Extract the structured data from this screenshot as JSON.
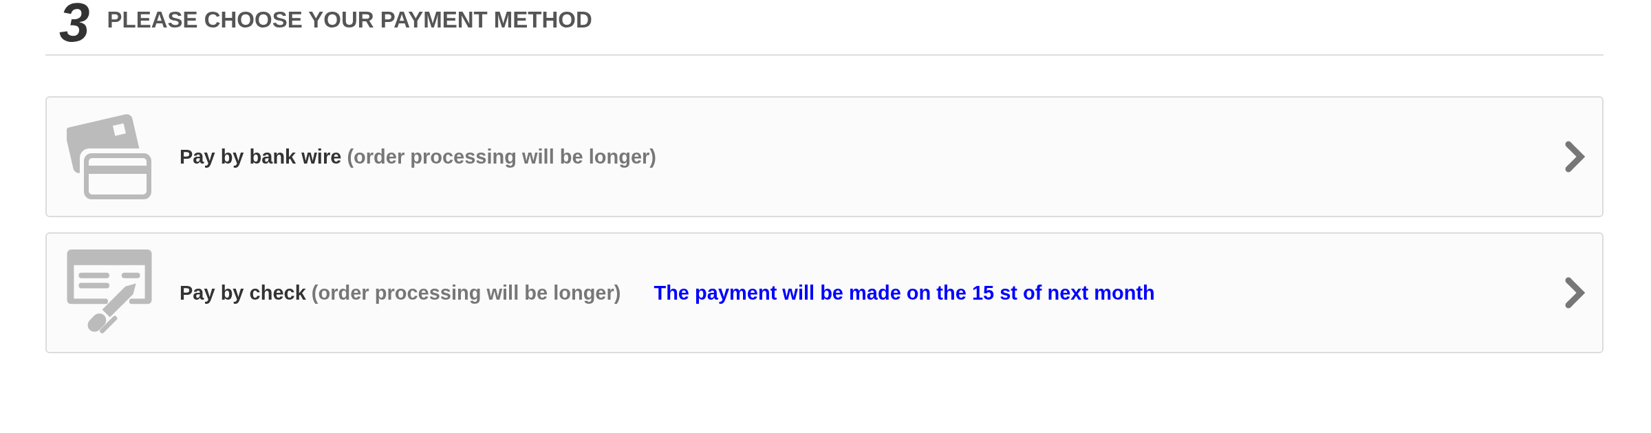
{
  "step": {
    "number": "3",
    "title": "PLEASE CHOOSE YOUR PAYMENT METHOD"
  },
  "payment_options": [
    {
      "kind": "bank_wire",
      "label": "Pay by bank wire",
      "note": "(order processing will be longer)"
    },
    {
      "kind": "check",
      "label": "Pay by check",
      "note": "(order processing will be longer)",
      "notice": "The payment will be made on the 15 st of next month"
    }
  ]
}
